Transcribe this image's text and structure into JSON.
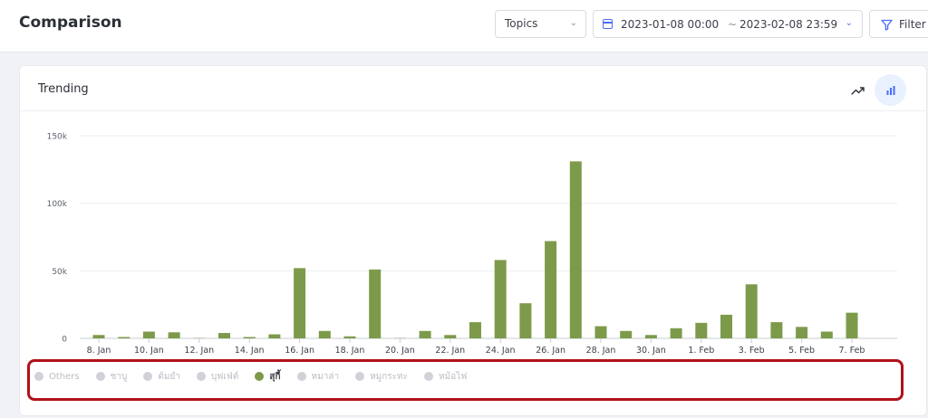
{
  "header": {
    "title": "Comparison",
    "topics_label": "Topics",
    "date_start": "2023-01-08 00:00",
    "date_sep": "~",
    "date_end": "2023-02-08 23:59",
    "filter_label": "Filter"
  },
  "card": {
    "title": "Trending"
  },
  "legend": [
    {
      "label": "Others",
      "active": false
    },
    {
      "label": "ชาบู",
      "active": false
    },
    {
      "label": "ต้มยำ",
      "active": false
    },
    {
      "label": "บุฟเฟ่ต์",
      "active": false
    },
    {
      "label": "สุกี้",
      "active": true
    },
    {
      "label": "หมาล่า",
      "active": false
    },
    {
      "label": "หมูกระทะ",
      "active": false
    },
    {
      "label": "หม้อไฟ",
      "active": false
    }
  ],
  "colors": {
    "bar": "#7d9a4b",
    "accent": "#4a6cf7",
    "highlight": "#b0121b"
  },
  "chart_data": {
    "type": "bar",
    "categories": [
      "2023-01-08",
      "2023-01-09",
      "2023-01-10",
      "2023-01-11",
      "2023-01-12",
      "2023-01-13",
      "2023-01-14",
      "2023-01-15",
      "2023-01-16",
      "2023-01-17",
      "2023-01-18",
      "2023-01-19",
      "2023-01-20",
      "2023-01-21",
      "2023-01-22",
      "2023-01-23",
      "2023-01-24",
      "2023-01-25",
      "2023-01-26",
      "2023-01-27",
      "2023-01-28",
      "2023-01-29",
      "2023-01-30",
      "2023-01-31",
      "2023-02-01",
      "2023-02-02",
      "2023-02-03",
      "2023-02-04",
      "2023-02-05",
      "2023-02-06",
      "2023-02-07"
    ],
    "series": [
      {
        "name": "สุกี้",
        "values": [
          2500,
          1000,
          5000,
          4500,
          200,
          4000,
          1000,
          3000,
          52000,
          5500,
          1500,
          51000,
          200,
          5500,
          2500,
          12000,
          58000,
          26000,
          72000,
          131000,
          9000,
          5500,
          2500,
          7500,
          11500,
          17500,
          40000,
          12000,
          8500,
          5000,
          19000
        ]
      }
    ],
    "xtick_labels": [
      "8. Jan",
      "10. Jan",
      "12. Jan",
      "14. Jan",
      "16. Jan",
      "18. Jan",
      "20. Jan",
      "22. Jan",
      "24. Jan",
      "26. Jan",
      "28. Jan",
      "30. Jan",
      "1. Feb",
      "3. Feb",
      "5. Feb",
      "7. Feb"
    ],
    "yticks": [
      0,
      50000,
      100000,
      150000
    ],
    "ytick_labels": [
      "0",
      "50k",
      "100k",
      "150k"
    ],
    "ylim": [
      0,
      150000
    ],
    "grid": true
  }
}
